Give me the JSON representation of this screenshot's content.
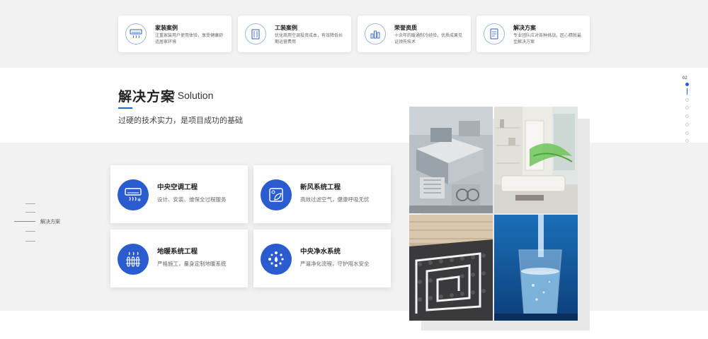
{
  "features": [
    {
      "icon": "air-conditioner-icon",
      "title": "家装案例",
      "desc": "注重家装用户使用体验，享受健康舒适居家环境"
    },
    {
      "icon": "building-icon",
      "title": "工装案例",
      "desc": "优化商用空调投资成本，有效降低长期运营费用"
    },
    {
      "icon": "trophy-chart-icon",
      "title": "荣誉资质",
      "desc": "十余年的暖通制冷经验，优质成果见证领先技术"
    },
    {
      "icon": "document-icon",
      "title": "解决方案",
      "desc": "专业团队应对各种挑战，匠心精就最佳解决方案"
    }
  ],
  "section": {
    "title": "解决方案",
    "title_en": "/ Solution",
    "subtitle": "过硬的技术实力，是项目成功的基础"
  },
  "side_nav": {
    "label": "解决方案"
  },
  "services": [
    {
      "icon": "air-conditioner-icon",
      "title": "中央空调工程",
      "desc": "设计、安装、维保全过程服务"
    },
    {
      "icon": "fresh-air-icon",
      "title": "新风系统工程",
      "desc": "高效过滤空气，健康呼吸无忧"
    },
    {
      "icon": "floor-heating-icon",
      "title": "地暖系统工程",
      "desc": "严格施工，量身定制地暖系统"
    },
    {
      "icon": "water-purifier-icon",
      "title": "中央净水系统",
      "desc": "严逼净化流程，守护用水安全"
    }
  ],
  "pager": {
    "current": "02",
    "total_dots": 8,
    "active_index": 0
  },
  "colors": {
    "accent": "#2660d5",
    "icon_bg": "#2a5ccf",
    "band_bg": "#f2f2f2"
  }
}
